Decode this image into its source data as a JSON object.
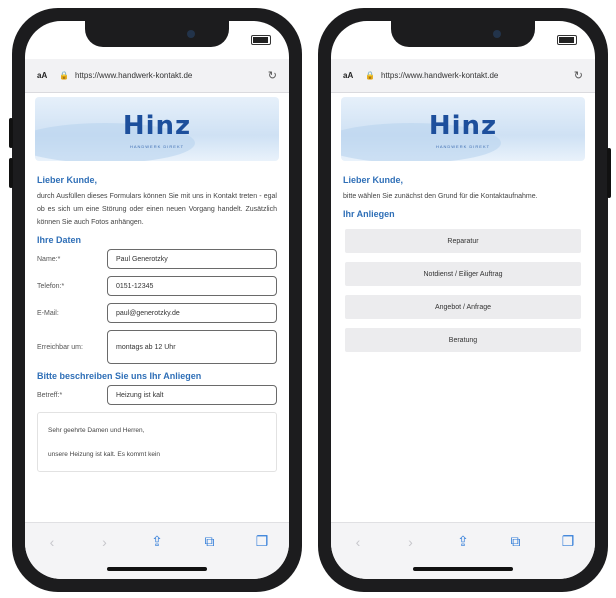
{
  "browser": {
    "aa_label": "aA",
    "lock_icon": "lock-icon",
    "url": "https://www.handwerk-kontakt.de",
    "reload_icon": "reload-icon"
  },
  "brand": {
    "logo": "Hinz",
    "tagline": "HANDWERK DIREKT",
    "accent": "#2f6fb7"
  },
  "left": {
    "greeting": "Lieber Kunde,",
    "intro": "durch Ausfüllen dieses Formulars können Sie mit uns in Kontakt treten - egal ob es sich um eine Störung oder einen neuen Vorgang handelt. Zusätzlich können Sie auch Fotos anhängen.",
    "section_data": "Ihre Daten",
    "fields": {
      "name": {
        "label": "Name:*",
        "value": "Paul Generotzky"
      },
      "phone": {
        "label": "Telefon:*",
        "value": "0151-12345"
      },
      "email": {
        "label": "E-Mail:",
        "value": "paul@generotzky.de"
      },
      "reachable": {
        "label": "Erreichbar um:",
        "value": "montags ab 12 Uhr"
      },
      "subject": {
        "label": "Betreff:*",
        "value": "Heizung ist kalt"
      }
    },
    "section_describe": "Bitte beschreiben Sie uns Ihr Anliegen",
    "message_line1": "Sehr geehrte Damen und Herren,",
    "message_line2": "unsere Heizung ist kalt. Es kommt kein"
  },
  "right": {
    "greeting": "Lieber Kunde,",
    "intro": "bitte wählen Sie zunächst den Grund für die Kontaktaufnahme.",
    "section": "Ihr Anliegen",
    "options": [
      "Reparatur",
      "Notdienst / Eiliger Auftrag",
      "Angebot / Anfrage",
      "Beratung"
    ]
  },
  "toolbar": {
    "back": "‹",
    "forward": "›",
    "share": "⇪",
    "bookmarks": "⧉",
    "tabs": "❐"
  }
}
